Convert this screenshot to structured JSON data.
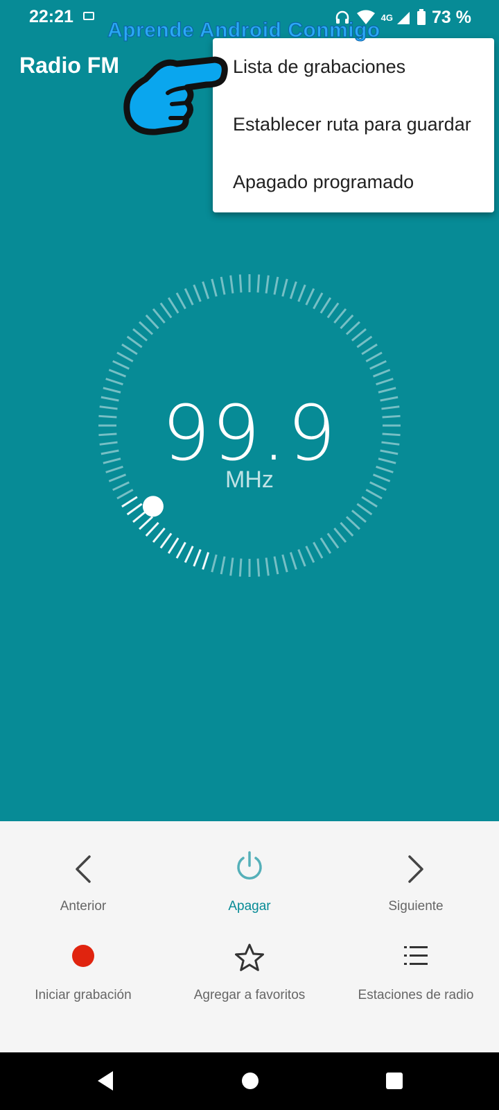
{
  "status_bar": {
    "time": "22:21",
    "network": "4G",
    "battery_percent": "73 %"
  },
  "watermark": "Aprende Android Conmigo",
  "app_title": "Radio FM",
  "menu": {
    "items": [
      {
        "label": "Lista de grabaciones"
      },
      {
        "label": "Establecer ruta para guardar"
      },
      {
        "label": "Apagado programado"
      }
    ]
  },
  "tuner": {
    "frequency": "99.9",
    "unit": "MHz",
    "dial_position": 0.2
  },
  "controls": {
    "row1": [
      {
        "label": "Anterior",
        "icon": "chevron-left-icon"
      },
      {
        "label": "Apagar",
        "icon": "power-icon"
      },
      {
        "label": "Siguiente",
        "icon": "chevron-right-icon"
      }
    ],
    "row2": [
      {
        "label": "Iniciar grabación",
        "icon": "record-icon"
      },
      {
        "label": "Agregar a favoritos",
        "icon": "star-icon"
      },
      {
        "label": "Estaciones de radio",
        "icon": "list-icon"
      }
    ]
  },
  "colors": {
    "background": "#078b96",
    "accent": "#078b96",
    "record": "#e0240f",
    "watermark": "#2aa9f5"
  }
}
